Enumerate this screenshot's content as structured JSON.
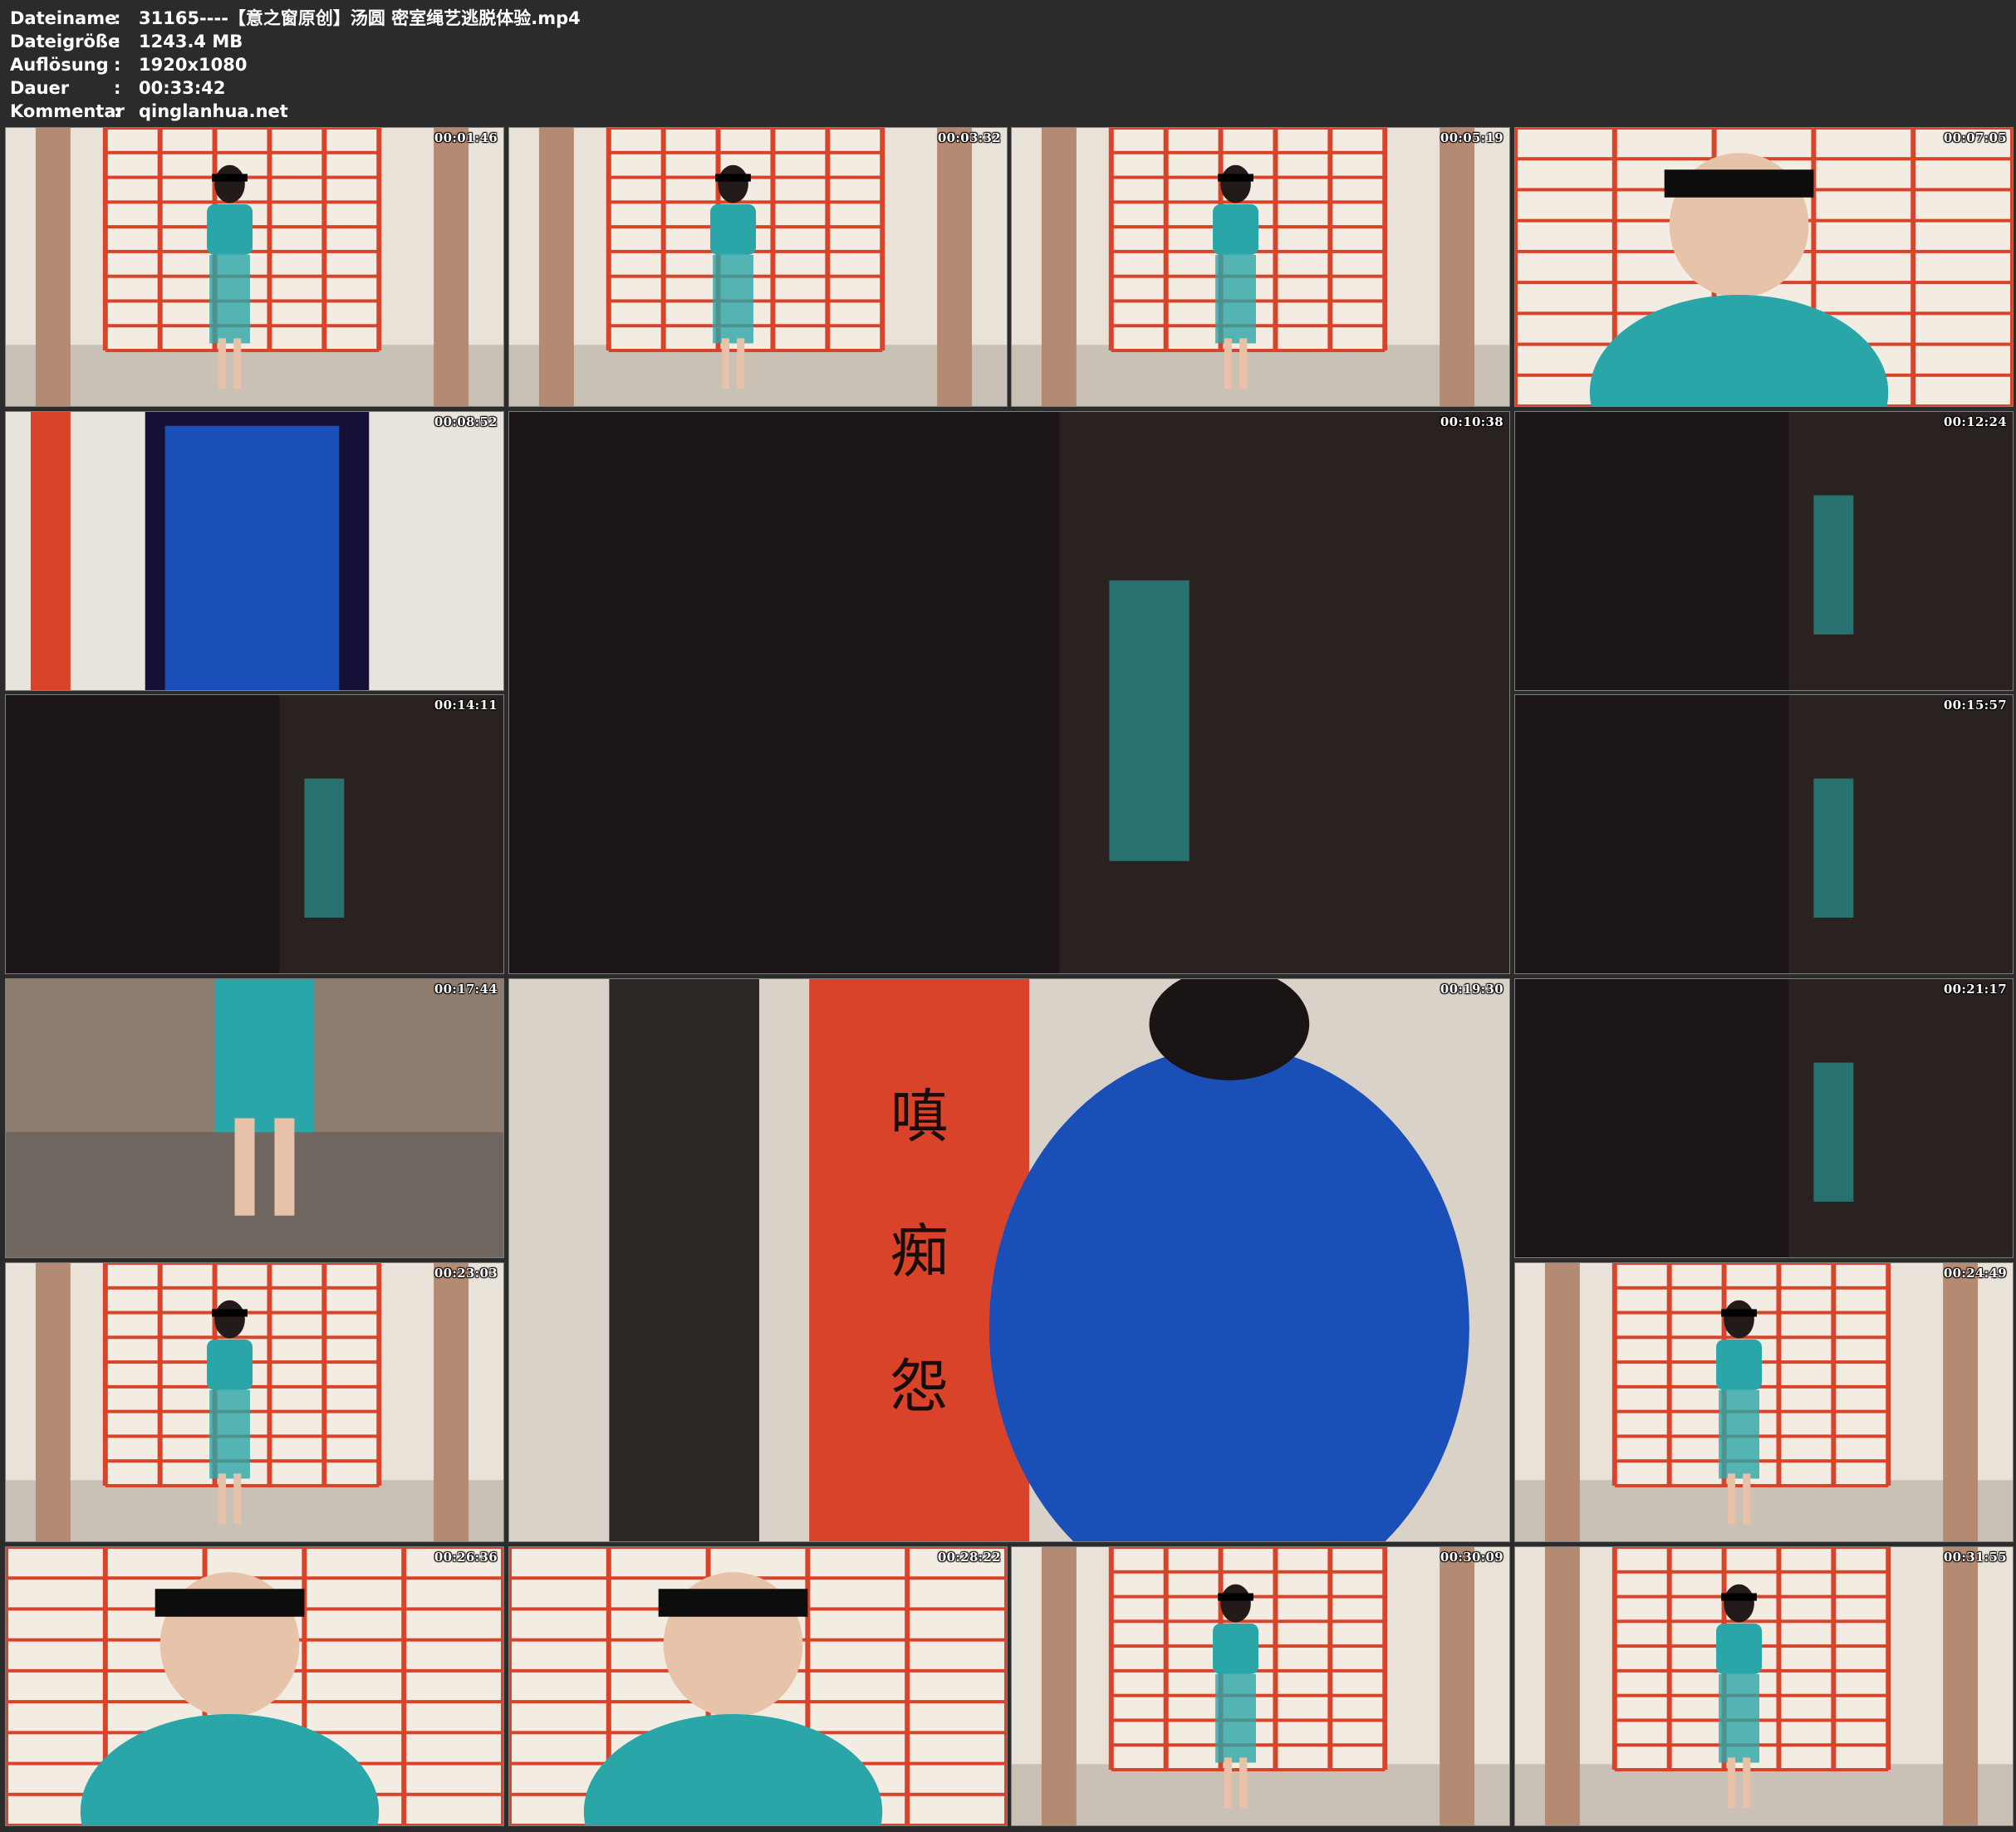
{
  "header": {
    "rows": [
      {
        "label": "Dateiname",
        "sep": ":",
        "value": "31165----【意之窗原创】汤圆 密室绳艺逃脱体验.mp4"
      },
      {
        "label": "Dateigröße",
        "sep": ":",
        "value": "1243.4 MB"
      },
      {
        "label": "Auflösung",
        "sep": ":",
        "value": "1920x1080"
      },
      {
        "label": "Dauer",
        "sep": ":",
        "value": "00:33:42"
      },
      {
        "label": "Kommentar",
        "sep": ":",
        "value": "qinglanhua.net"
      }
    ]
  },
  "thumbnails": [
    {
      "timestamp": "00:01:46",
      "scene": "bright"
    },
    {
      "timestamp": "00:03:32",
      "scene": "bright"
    },
    {
      "timestamp": "00:05:19",
      "scene": "bright"
    },
    {
      "timestamp": "00:07:05",
      "scene": "closeup"
    },
    {
      "timestamp": "00:08:52",
      "scene": "blue"
    },
    {
      "timestamp": "00:10:38",
      "scene": "dark"
    },
    {
      "timestamp": "00:12:24",
      "scene": "dark"
    },
    {
      "timestamp": "00:14:11",
      "scene": "dark"
    },
    {
      "timestamp": "00:15:57",
      "scene": "dark"
    },
    {
      "timestamp": "00:17:44",
      "scene": "floor"
    },
    {
      "timestamp": "00:19:30",
      "scene": "pillar"
    },
    {
      "timestamp": "00:21:17",
      "scene": "dark"
    },
    {
      "timestamp": "00:23:03",
      "scene": "bright"
    },
    {
      "timestamp": "00:24:49",
      "scene": "bright"
    },
    {
      "timestamp": "00:26:36",
      "scene": "closeup"
    },
    {
      "timestamp": "00:28:22",
      "scene": "closeup"
    },
    {
      "timestamp": "00:30:09",
      "scene": "bright"
    },
    {
      "timestamp": "00:31:55",
      "scene": "bright"
    }
  ],
  "pillar_text": [
    "嗔",
    "痴",
    "怨"
  ],
  "colors": {
    "background": "#2b2b2b",
    "border": "#7f7f7f",
    "door_red": "#d8432a",
    "wall": "#e9e2d8",
    "dark": "#1c1517",
    "teal": "#2aa6a8",
    "shirt_blue": "#1b4fb8"
  }
}
